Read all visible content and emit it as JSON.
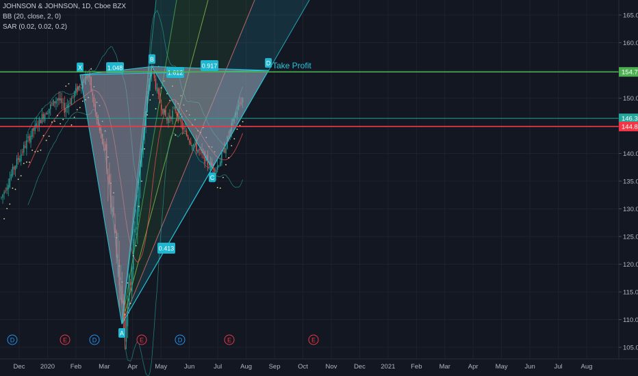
{
  "legend": {
    "symbol": "JOHNSON & JOHNSON, 1D, Cboe BZX",
    "bb": "BB (20, close, 2, 0)",
    "sar": "SAR (0.02, 0.02, 0.2)"
  },
  "colors": {
    "background": "#131722",
    "pattern_fill": "#9aa3b4",
    "pattern_stroke": "#26c6da",
    "green_line": "#4caf50",
    "red_line": "#f23645",
    "teal_line": "#26a69a",
    "label_bg": "#1fb6d0",
    "earnings": "#f23645",
    "dividend": "#2196f3"
  },
  "price_axis": {
    "ticks": [
      "165.00",
      "160.00",
      "155.00",
      "150.00",
      "145.00",
      "140.00",
      "135.00",
      "130.00",
      "125.00",
      "120.00",
      "115.00",
      "110.00",
      "105.00"
    ],
    "tags": [
      {
        "value": "154.73",
        "color": "#4caf50"
      },
      {
        "value": "146.34",
        "color": "#26a69a"
      },
      {
        "value": "144.87",
        "color": "#f23645"
      }
    ]
  },
  "time_axis": [
    "Dec",
    "2020",
    "Feb",
    "Mar",
    "Apr",
    "May",
    "Jun",
    "Jul",
    "Aug",
    "Sep",
    "Oct",
    "Nov",
    "Dec",
    "2021",
    "Feb",
    "Mar",
    "Apr",
    "May",
    "Jun",
    "Jul",
    "Aug"
  ],
  "harmonic": {
    "points": [
      {
        "label": "X",
        "price": 154.2
      },
      {
        "label": "A",
        "price": 109.2
      },
      {
        "label": "B",
        "price": 155.7
      },
      {
        "label": "C",
        "price": 137.3
      },
      {
        "label": "D",
        "price": 155.0
      }
    ],
    "ratios": [
      {
        "id": "xb",
        "value": "1.048"
      },
      {
        "id": "ac",
        "value": "1.612"
      },
      {
        "id": "bd",
        "value": "0.917"
      },
      {
        "id": "xd",
        "value": "0.413"
      }
    ],
    "take_profit_label": "Take Profit"
  },
  "events": [
    {
      "type": "dividend",
      "letter": "D"
    },
    {
      "type": "earnings",
      "letter": "E"
    },
    {
      "type": "dividend",
      "letter": "D"
    },
    {
      "type": "earnings",
      "letter": "E"
    },
    {
      "type": "dividend",
      "letter": "D"
    },
    {
      "type": "earnings",
      "letter": "E"
    },
    {
      "type": "earnings",
      "letter": "E"
    }
  ]
}
